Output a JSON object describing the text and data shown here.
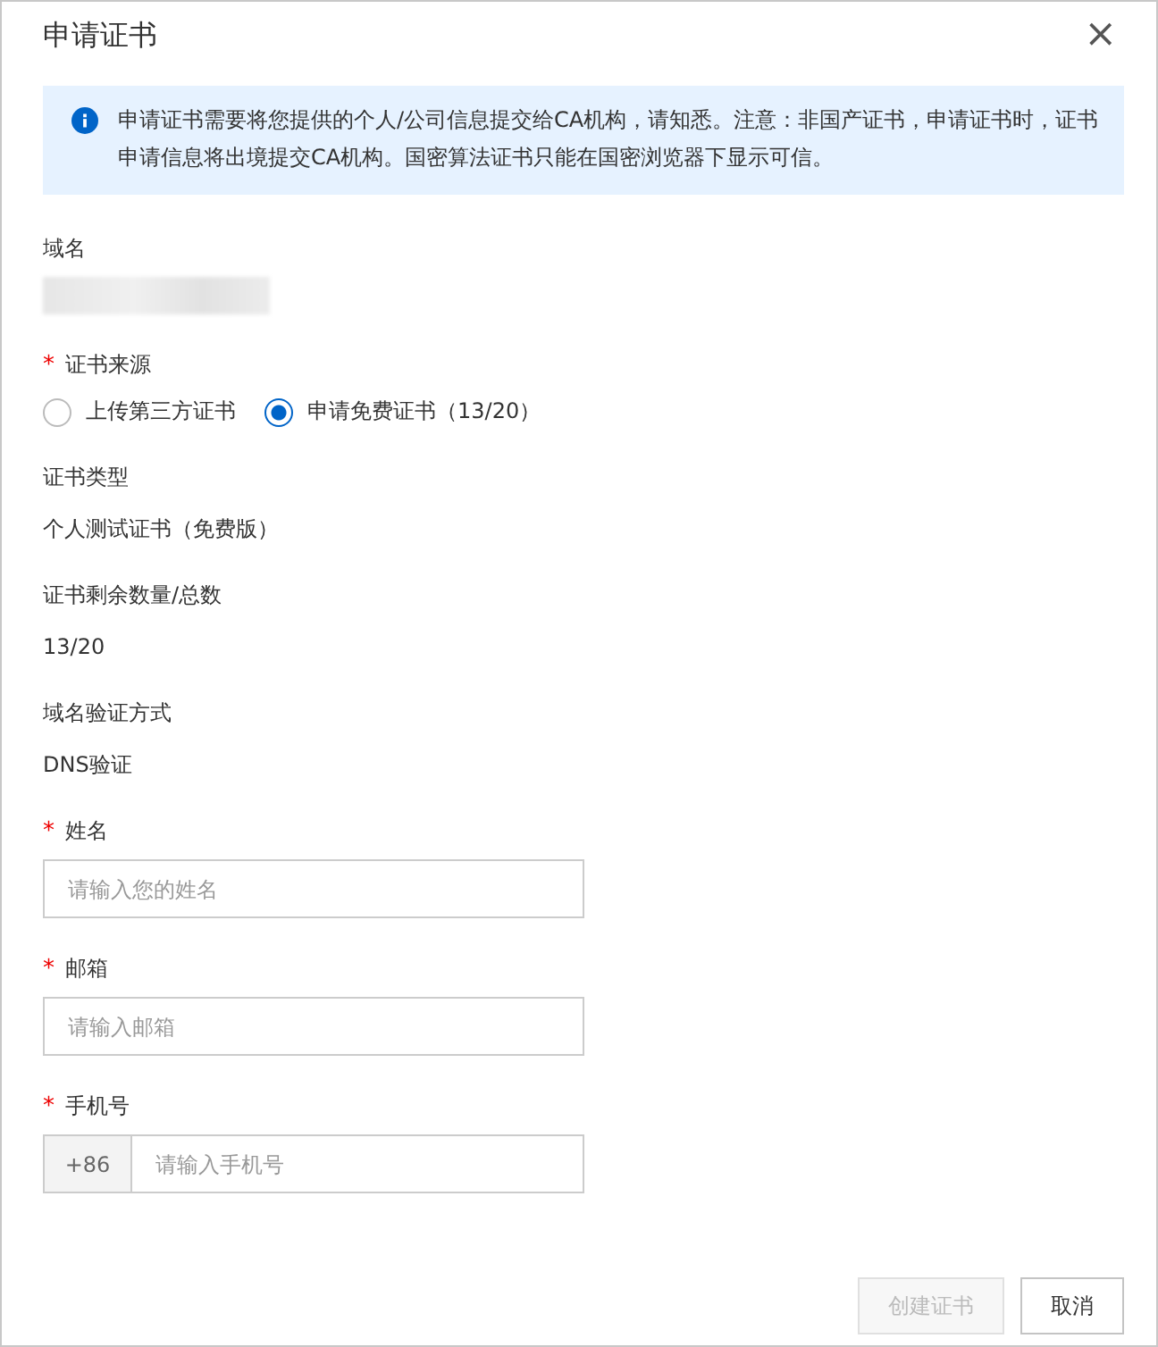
{
  "dialog": {
    "title": "申请证书",
    "close": "×"
  },
  "alert": {
    "text": "申请证书需要将您提供的个人/公司信息提交给CA机构，请知悉。注意：非国产证书，申请证书时，证书申请信息将出境提交CA机构。国密算法证书只能在国密浏览器下显示可信。"
  },
  "fields": [
    {
      "kind": "redacted",
      "label": "域名"
    },
    {
      "kind": "radio",
      "label": "证书来源",
      "required_mark": "*",
      "options": [
        {
          "label": "上传第三方证书",
          "selected": false
        },
        {
          "label": "申请免费证书（13/20）",
          "selected": true
        }
      ]
    },
    {
      "kind": "text",
      "label": "证书类型",
      "value": "个人测试证书（免费版）"
    },
    {
      "kind": "text",
      "label": "证书剩余数量/总数",
      "value": "13/20"
    },
    {
      "kind": "text",
      "label": "域名验证方式",
      "value": "DNS验证"
    },
    {
      "kind": "input",
      "label": "姓名",
      "required_mark": "*",
      "placeholder": "请输入您的姓名"
    },
    {
      "kind": "input",
      "label": "邮箱",
      "required_mark": "*",
      "placeholder": "请输入邮箱"
    },
    {
      "kind": "phone",
      "label": "手机号",
      "required_mark": "*",
      "prefix": "+86",
      "placeholder": "请输入手机号"
    }
  ],
  "buttons": [
    {
      "label": "创建证书",
      "disabled": true
    },
    {
      "label": "取消",
      "disabled": false
    }
  ]
}
